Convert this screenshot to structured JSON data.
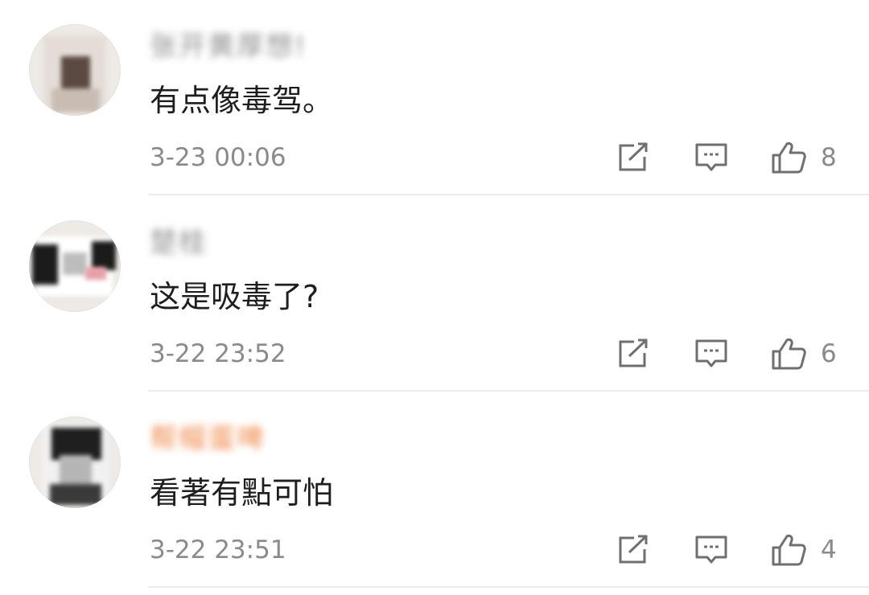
{
  "comments": [
    {
      "username": "张开黄厚想!",
      "text": "有点像毒驾。",
      "time": "3-23 00:06",
      "likes": "8",
      "username_color": "#8f8f8f"
    },
    {
      "username": "楚桂",
      "text": "这是吸毒了?",
      "time": "3-22 23:52",
      "likes": "6",
      "username_color": "#8f8f8f"
    },
    {
      "username": "帮帽蛋啤",
      "text": "看著有點可怕",
      "time": "3-22 23:51",
      "likes": "4",
      "username_color": "#f08a4a"
    }
  ],
  "icons": {
    "repost": "repost-icon",
    "reply": "reply-icon",
    "like": "thumbs-up-icon"
  }
}
